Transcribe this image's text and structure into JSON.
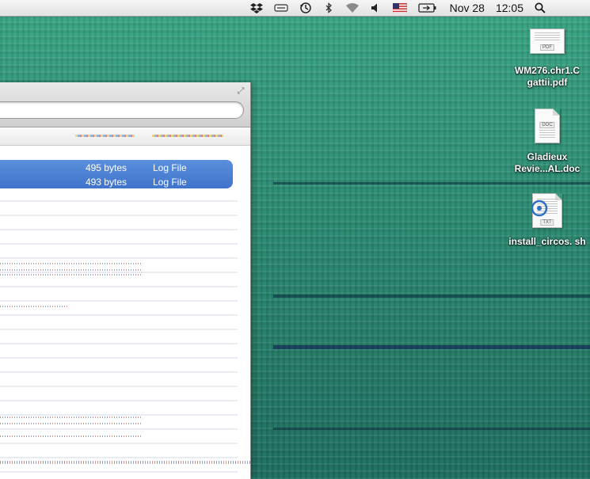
{
  "menubar": {
    "icons": [
      "dropbox-icon",
      "sync-icon",
      "time-machine-icon",
      "bluetooth-icon",
      "wifi-icon",
      "volume-icon",
      "flag-icon",
      "battery-icon",
      "spotlight-search-icon"
    ],
    "date": "Nov 28",
    "time": "12:05"
  },
  "window": {
    "rows": [
      {
        "size": "495 bytes",
        "kind": "Log File",
        "selected": true
      },
      {
        "size": "493 bytes",
        "kind": "Log File",
        "selected": true
      }
    ],
    "selection_color": "#3f74cc"
  },
  "desktop": {
    "icons": [
      {
        "label": "WM276.chr1.C gattii.pdf",
        "type": "pdf-icon",
        "tag": "PDF"
      },
      {
        "label": "Gladieux Revie...AL.doc",
        "type": "doc-icon",
        "tag": "DOC"
      },
      {
        "label": "install_circos. sh",
        "type": "text-icon",
        "tag": "TXT"
      }
    ]
  },
  "colors": {
    "desktop": "#2f8f74",
    "menubar": "#e8e8e8"
  }
}
